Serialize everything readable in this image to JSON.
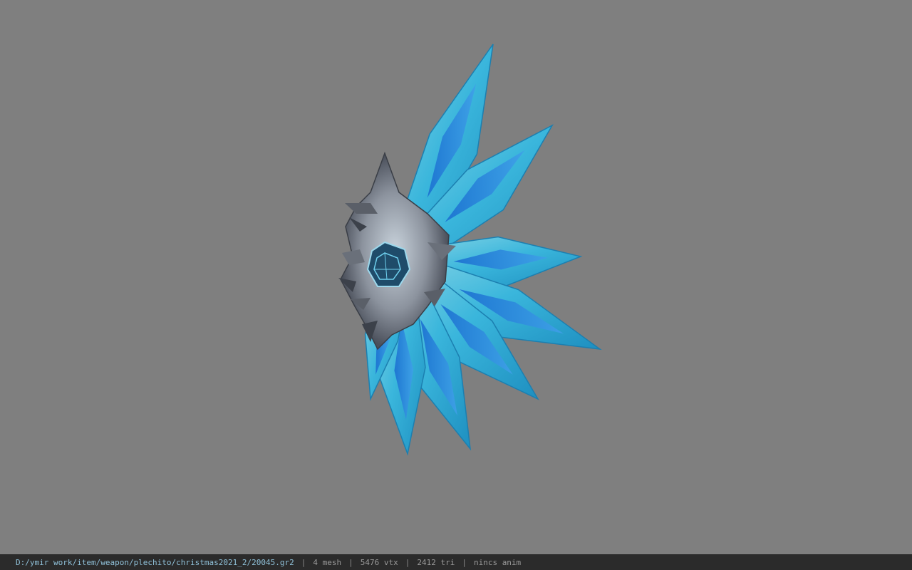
{
  "viewer": {
    "background_color": "#7f7f7f",
    "model_subject": "blue crystal fan weapon"
  },
  "statusbar": {
    "file_path": "D:/ymir work/item/weapon/plechito/christmas2021_2/20045.gr2",
    "separator": "|",
    "mesh": "4 mesh",
    "vtx": "5476 vtx",
    "tri": "2412 tri",
    "anim": "nincs anim"
  }
}
